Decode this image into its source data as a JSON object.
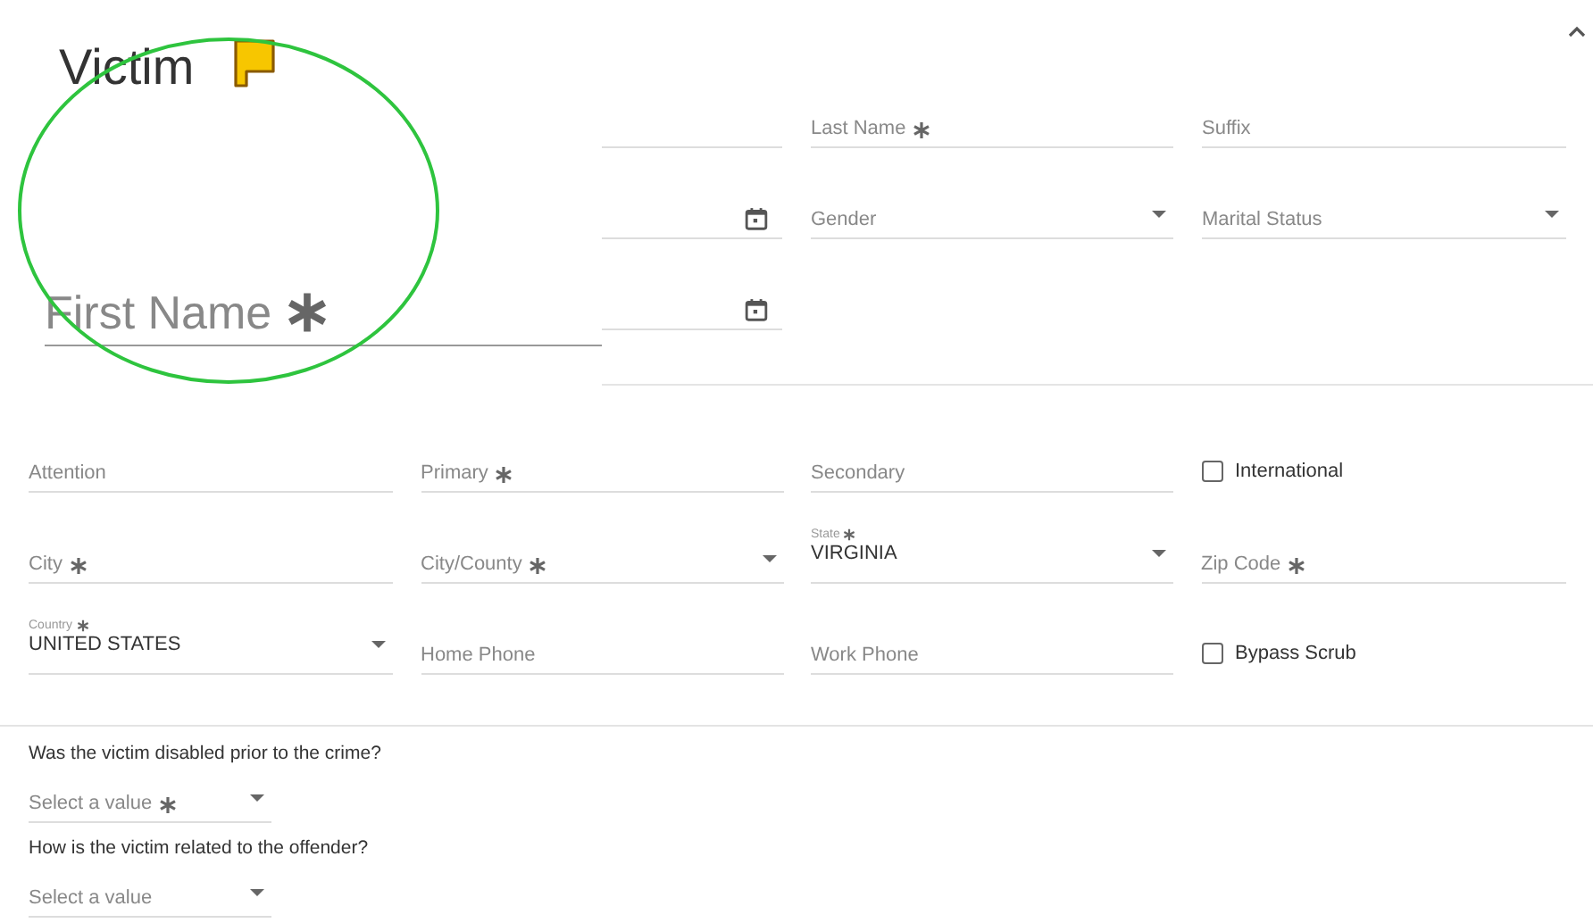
{
  "section": {
    "title": "Victim",
    "flagged": true,
    "collapsible": true
  },
  "name_field": {
    "label": "First Name",
    "required": true
  },
  "top_fields": [
    {
      "kind": "text",
      "required": false
    },
    {
      "kind": "text",
      "label": "Last Name",
      "required": true
    },
    {
      "kind": "text",
      "label": "Suffix",
      "required": false
    },
    {
      "kind": "date",
      "required": false
    },
    {
      "kind": "select",
      "label": "Gender",
      "required": false
    },
    {
      "kind": "select",
      "label": "Marital Status",
      "required": false
    },
    {
      "kind": "date",
      "required": false
    }
  ],
  "address_fields": [
    {
      "kind": "text",
      "label": "Attention",
      "required": false
    },
    {
      "kind": "text",
      "label": "Primary",
      "required": true
    },
    {
      "kind": "text",
      "label": "Secondary",
      "required": false
    },
    {
      "kind": "checkbox",
      "label": "International",
      "checked": false
    },
    {
      "kind": "text",
      "label": "City",
      "required": true
    },
    {
      "kind": "select",
      "label": "City/County",
      "required": true
    },
    {
      "kind": "select",
      "label": "State",
      "required": true,
      "value": "VIRGINIA"
    },
    {
      "kind": "text",
      "label": "Zip Code",
      "required": true
    },
    {
      "kind": "select",
      "label": "Country",
      "required": true,
      "value": "UNITED STATES"
    },
    {
      "kind": "text",
      "label": "Home Phone",
      "required": false
    },
    {
      "kind": "text",
      "label": "Work Phone",
      "required": false
    },
    {
      "kind": "checkbox",
      "label": "Bypass Scrub",
      "checked": false
    }
  ],
  "questions": [
    {
      "text": "Was the victim disabled prior to the crime?",
      "placeholder": "Select a value",
      "required": true
    },
    {
      "text": "How is the victim related to the offender?",
      "placeholder": "Select a value",
      "required": false
    }
  ]
}
